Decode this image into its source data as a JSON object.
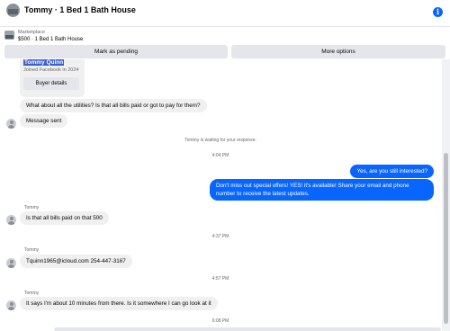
{
  "header": {
    "title": "Tommy · 1 Bed 1 Bath House",
    "info_icon": "info-icon"
  },
  "listing": {
    "label": "Marketplace",
    "price_line": "$500 · 1 Bed 1 Bath House"
  },
  "actions": {
    "pending": "Mark as pending",
    "more": "More options"
  },
  "buyer_card": {
    "name": "Tommy Quinn",
    "joined": "Joined Facebook in 2024",
    "details_button": "Buyer details"
  },
  "messages": {
    "m1": "What about all the utilities? Is that all bills paid or got to pay for them?",
    "m2": "Message sent",
    "system": "Tommy is waiting for your response.",
    "t1": "4:04 PM",
    "o1": "Yes, are you still interested?",
    "o2": "Don't miss out special offers! YES! it's available! Share your email and phone number to receive the latest updates.",
    "sender1": "Tommy",
    "m3": "Is that all bills paid on that 500",
    "t2": "4:37 PM",
    "sender2": "Tommy",
    "m4": "Tquinn1965@icloud.com  254-447-3167",
    "t3": "4:57 PM",
    "sender3": "Tommy",
    "m5": "It says I'm about 10 minutes from there. Is it somewhere I can go look at it",
    "t4": "6:08 PM"
  },
  "colors": {
    "accent": "#0866ff",
    "bubble_in": "#f0f0f0",
    "button": "#e4e6eb"
  }
}
